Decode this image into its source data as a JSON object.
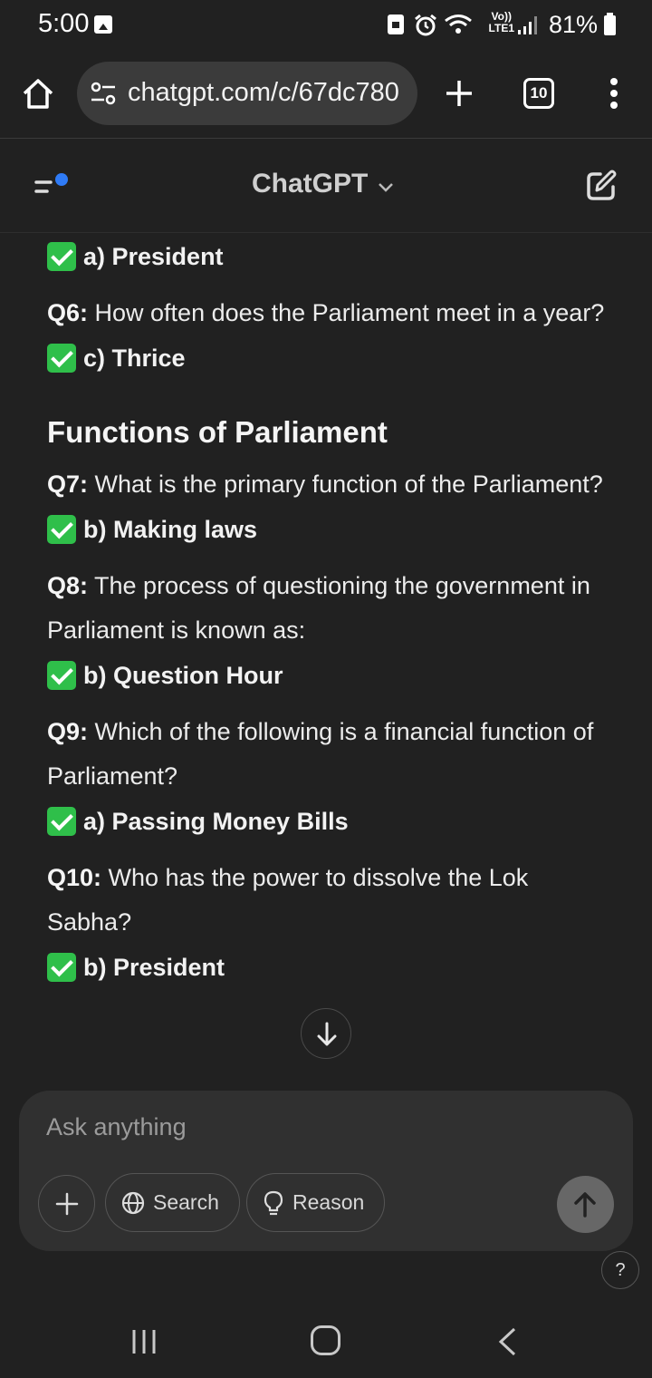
{
  "status_bar": {
    "time": "5:00",
    "battery_percent": "81%",
    "network_label_top": "Vo))",
    "network_label_bottom": "LTE1"
  },
  "browser": {
    "url": "chatgpt.com/c/67dc780",
    "tab_count": "10"
  },
  "header": {
    "title": "ChatGPT"
  },
  "chat": {
    "items": [
      {
        "type": "answer",
        "text": "a) President"
      },
      {
        "type": "question",
        "label": "Q6:",
        "text": " How often does the Parliament meet in a year?"
      },
      {
        "type": "answer",
        "text": "c) Thrice"
      },
      {
        "type": "heading",
        "text": "Functions of Parliament"
      },
      {
        "type": "question",
        "label": "Q7:",
        "text": " What is the primary function of the Parliament?"
      },
      {
        "type": "answer",
        "text": "b) Making laws"
      },
      {
        "type": "question",
        "label": "Q8:",
        "text": " The process of questioning the government in Parliament is known as:"
      },
      {
        "type": "answer",
        "text": "b) Question Hour"
      },
      {
        "type": "question",
        "label": "Q9:",
        "text": " Which of the following is a financial function of Parliament?"
      },
      {
        "type": "answer",
        "text": "a) Passing Money Bills"
      },
      {
        "type": "question",
        "label": "Q10:",
        "text": " Who has the power to dissolve the Lok Sabha?"
      },
      {
        "type": "answer",
        "text": "b) President"
      }
    ]
  },
  "composer": {
    "placeholder": "Ask anything",
    "search_label": "Search",
    "reason_label": "Reason"
  },
  "help_label": "?",
  "colors": {
    "background": "#212121",
    "composer": "#303030",
    "check_green": "#2fbf4a",
    "sidebar_dot": "#2f7bf6"
  }
}
